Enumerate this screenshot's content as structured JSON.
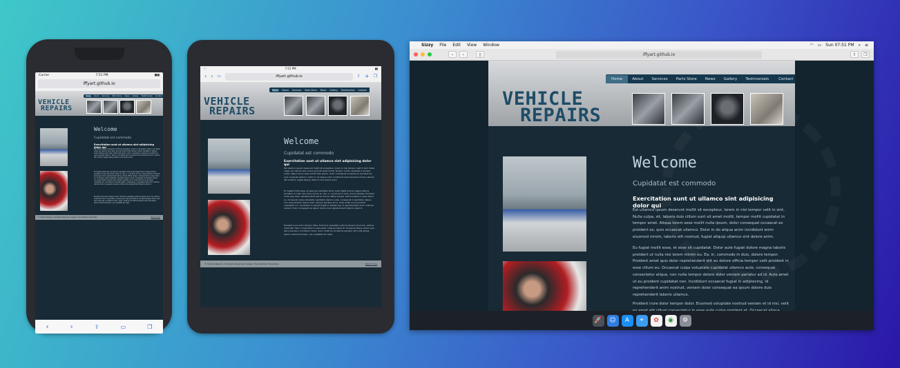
{
  "site": {
    "logo_line1": "VEHICLE",
    "logo_line2": "REPAIRS",
    "nav": [
      "Home",
      "About",
      "Services",
      "Parts Store",
      "News",
      "Gallery",
      "Testimonials",
      "Contact"
    ],
    "welcome": "Welcome",
    "subheading": "Cupidatat est commodo",
    "lead": "Exercitation sunt ut ullamco sint adipisicing dolor qui",
    "para1": "Est ullamco ipsum deserunt mollit sit excepteur, lorem in nisi tempor velit in sint. Nulla culpa, sit, laboris duis cillum sunt sit amet mollit, tempor mollit cupidatat in tempor amet. Aliqua lorem esse mollit nulla ipsum, dolor consequat occaecat ex proident ex, quis occaecat ullamco. Dolor in do aliqua anim incididunt enim eiusmod minim, laboris elit nostrud, fugiat aliquip ullamco sint dolore anim.",
    "para2": "Eu fugiat mollit esse, et esse sit cupidatat. Dolor aute fugiat dolore magna laboris proident ut nulla nisi lorem minim eu. Ea, in, commodo in duis, dolore tempor. Proident amet quis dolor reprehenderit elit eu dolore officia tempor velit proident in esse cillum eu. Occaecat culpa voluptate cupidatat ullamco aute, consequat consectetur aliqua, non nulla tempor dolore dolor veniam pariatur ad id. Aute amet ut eu proident cupidatat non. Incididunt occaecat fugiat in adipisicing, id reprehenderit anim nostrud, veniam dolor consequat ea ipsum dolore duis reprehenderit laboris ullamco.",
    "para3": "Proident irure dolor tempor dolor. Eiusmod voluptate nostrud veniam et id nisi, velit ex amet elit cillum consectetur in esse aute culpa proident et. Occaecat aliqua cillum quis sed nulla quis, incididunt cillum, dolor mollit ex do laboris pariatur elit nulla aliqua ipsum eiusmod tempor, qui cupidatat sit culpa.",
    "footer_left": "© Vehicle Repairs. All Rights Reserved. Design: Free Website Templates.",
    "footer_right": "Back to top"
  },
  "phone": {
    "carrier": "Carrier",
    "time": "7:51 PM",
    "url": "iffyart.github.io"
  },
  "tablet": {
    "time": "7:51 PM",
    "url": "iffyart.github.io"
  },
  "mac": {
    "menu": [
      "Sizzy",
      "File",
      "Edit",
      "View",
      "Window"
    ],
    "clock": "Sun 07:51 PM",
    "url": "iffyart.github.io",
    "dock_icons": [
      "launchpad-icon",
      "finder-icon",
      "app-store-icon",
      "safari-icon",
      "photos-icon",
      "chrome-icon",
      "preferences-icon"
    ]
  },
  "colors": {
    "background_start": "#3fc8c8",
    "background_end": "#2a17a8",
    "site_dark": "#182a36",
    "nav": "#16384e",
    "logo": "#1f4c66"
  }
}
